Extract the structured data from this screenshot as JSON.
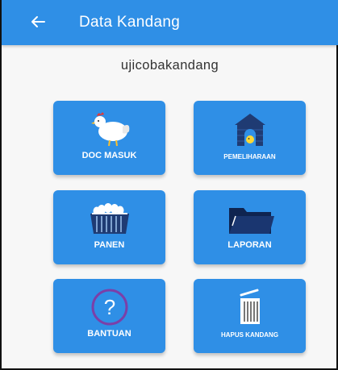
{
  "appbar": {
    "title": "Data Kandang",
    "back_icon": "arrow-left-icon"
  },
  "kandang": {
    "name": "ujicobakandang"
  },
  "menu": {
    "doc_masuk": "DOC MASUK",
    "pemeliharaan": "PEMELIHARAAN",
    "panen": "PANEN",
    "laporan": "LAPORAN",
    "bantuan": "BANTUAN",
    "hapus_kandang": "HAPUS KANDANG"
  },
  "colors": {
    "primary": "#2f8fe6",
    "background": "#f7f7f7"
  }
}
